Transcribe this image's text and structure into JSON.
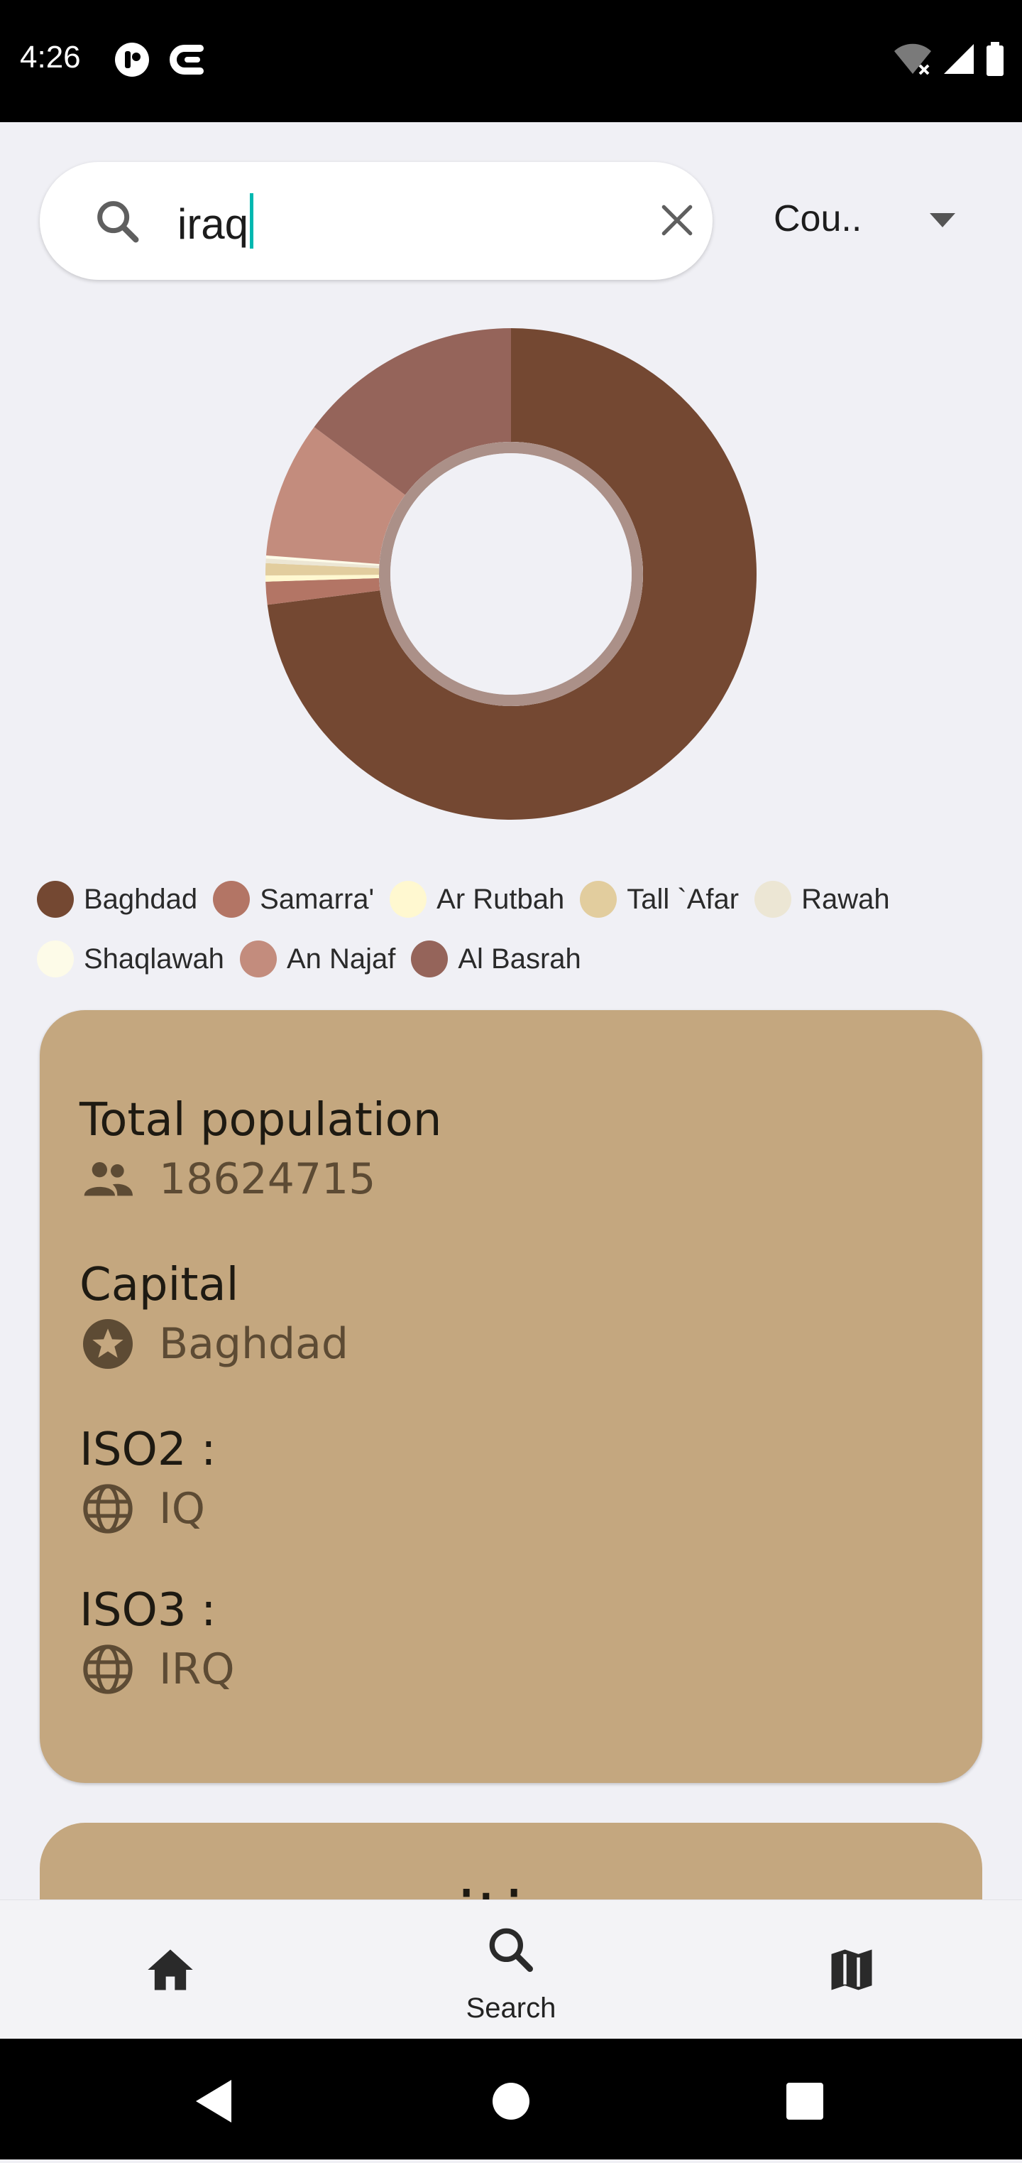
{
  "status_bar": {
    "time": "4:26",
    "icons": [
      "app-notification-icon",
      "app-notification-icon-2",
      "wifi-off-icon",
      "signal-icon",
      "battery-icon"
    ]
  },
  "search": {
    "query": "iraq",
    "placeholder": "",
    "icons": [
      "search-icon",
      "clear-icon"
    ]
  },
  "filter_dropdown": {
    "selected": "Cou..",
    "icon": "dropdown-arrow-icon"
  },
  "chart_data": {
    "type": "pie",
    "categories": [
      "Baghdad",
      "Samarra'",
      "Ar Rutbah",
      "Tall `Afar",
      "Rawah",
      "Shaqlawah",
      "An Najaf",
      "Al Basrah"
    ],
    "values": [
      73,
      1.5,
      0.4,
      0.8,
      0.3,
      0.2,
      9.0,
      14.8
    ],
    "colors": [
      "#744832",
      "#b37565",
      "#fff8d0",
      "#e2cd9e",
      "#ece6d4",
      "#fdfbe8",
      "#c38c7d",
      "#95645a"
    ]
  },
  "info_card": {
    "total_population_label": "Total population",
    "total_population_value": "18624715",
    "capital_label": "Capital",
    "capital_value": "Baghdad",
    "iso2_label": "ISO2 :",
    "iso2_value": "IQ",
    "iso3_label": "ISO3 :",
    "iso3_value": "IRQ",
    "icons": [
      "people-icon",
      "star-circle-icon",
      "globe-icon",
      "globe-icon"
    ]
  },
  "cities_card": {
    "title": "cities"
  },
  "bottom_nav": {
    "items": [
      {
        "icon": "home-icon",
        "label": ""
      },
      {
        "icon": "search-icon",
        "label": "Search"
      },
      {
        "icon": "map-icon",
        "label": ""
      }
    ]
  },
  "system_nav": {
    "icons": [
      "back-icon",
      "home-circle-icon",
      "recents-icon"
    ]
  }
}
